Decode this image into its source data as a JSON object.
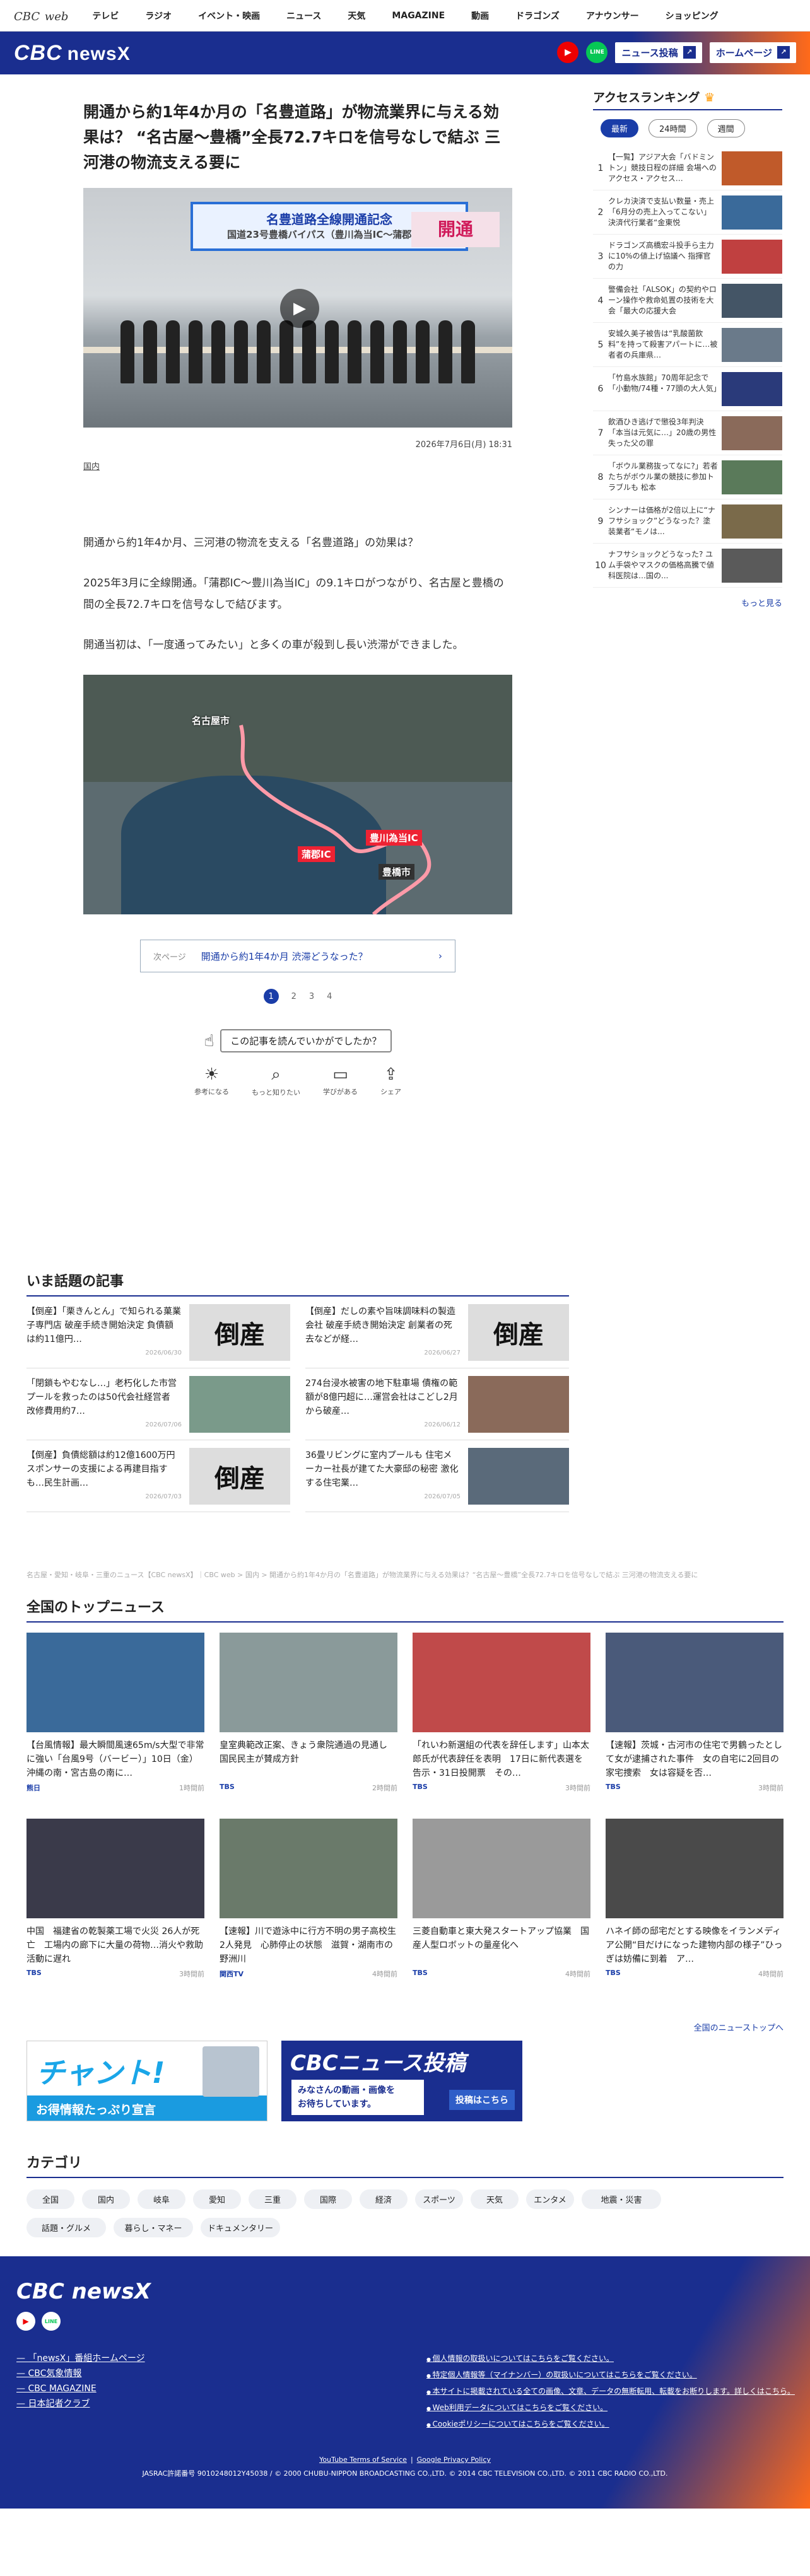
{
  "topnav": {
    "logo": "CBC",
    "logo_sub": "web",
    "items": [
      "テレビ",
      "ラジオ",
      "イベント・映画",
      "ニュース",
      "天気",
      "MAGAZINE",
      "動画",
      "ドラゴンズ",
      "アナウンサー",
      "ショッピング"
    ]
  },
  "header": {
    "brand": "CBC",
    "brand_sub": "newsX",
    "yt": "▶",
    "line": "LINE",
    "post": "ニュース投稿",
    "home": "ホームページ"
  },
  "article": {
    "title": "開通から約1年4か月の「名豊道路」が物流業界に与える効果は？ “名古屋～豊橋”全長72.7キロを信号なしで結ぶ 三河港の物流支える要に",
    "hero_arch": "名豊道路全線開通記念",
    "hero_arch_sub": "国道23号豊橋バイパス（豊川為当IC～蒲郡IC）",
    "hero_sign": "開通",
    "date": "2026年7月6日(月) 18:31",
    "category": "国内",
    "paras": [
      "開通から約1年4か月、三河港の物流を支える「名豊道路」の効果は？",
      "2025年3月に全線開通。「蒲郡IC～豊川為当IC」の9.1キロがつながり、名古屋と豊橋の間の全長72.7キロを信号なしで結びます。",
      "開通当初は、「一度通ってみたい」と多くの車が殺到し長い渋滞ができました。"
    ],
    "map": {
      "nagoya": "名古屋市",
      "gamagori": "蒲郡IC",
      "toyokawa": "豊川為当IC",
      "toyohashi": "豊橋市"
    },
    "next_label": "次ページ",
    "next_title": "開通から約1年4か月 渋滞どうなった？",
    "pages": [
      "1",
      "2",
      "3",
      "4"
    ],
    "ask": "この記事を読んでいかがでしたか？",
    "reactions": [
      {
        "i": "☀",
        "l": "参考になる"
      },
      {
        "i": "⌕",
        "l": "もっと知りたい"
      },
      {
        "i": "▭",
        "l": "学びがある"
      },
      {
        "i": "⇪",
        "l": "シェア"
      }
    ]
  },
  "ranking": {
    "title": "アクセスランキング",
    "tabs": [
      "最新",
      "24時間",
      "週間"
    ],
    "items": [
      {
        "n": "1",
        "t": "【一覧】アジア大会「バドミントン」競技日程の詳細 会場へのアクセス・アクセス…"
      },
      {
        "n": "2",
        "t": "クレカ決済で支払い数量・売上「6月分の売上入ってこない」決済代行業者“金東悦"
      },
      {
        "n": "3",
        "t": "ドラゴンズ高橋宏斗投手ら主力に10%の値上げ協議へ 指揮官の力"
      },
      {
        "n": "4",
        "t": "警備会社「ALSOK」の契約やローン操作や救命処置の技術を大会「最大の応援大会"
      },
      {
        "n": "5",
        "t": "安城久美子被告は“乳酸菌飲料”を持って殺害アパートに…被者者の兵庫県…"
      },
      {
        "n": "6",
        "t": "「竹島水族館」70周年記念で「小動物/74種・77頭の大人気」"
      },
      {
        "n": "7",
        "t": "飲酒ひき逃げで懲役3年判決「本当は元気に…」20歳の男性失った父の罪"
      },
      {
        "n": "8",
        "t": "「ボウル業務抜ってなに?」若者たちがボウル業の競技に参加トラブルも 松本"
      },
      {
        "n": "9",
        "t": "シンナーは価格が2倍以上に“ナフサショック”どうなった？塗装業者“モノは..."
      },
      {
        "n": "10",
        "t": "ナフサショックどうなった? ユム手袋やマスクの価格高騰で値科医院は…国の..."
      }
    ],
    "more": "もっと見る"
  },
  "trend": {
    "title": "いま話題の記事",
    "items": [
      {
        "t": "【倒産】「栗きんとん」で知られる菓業子専門店 破産手続き開始決定 負債額は約11億円…",
        "d": "2026/06/30",
        "im": "倒産"
      },
      {
        "t": "【倒産】だしの素や旨味調味料の製造会社 破産手続き開始決定 創業者の死去などが経…",
        "d": "2026/06/27",
        "im": "倒産"
      },
      {
        "t": "「閉鎖もやむなし…」老朽化した市営プールを救ったのは50代会社経営者 改修費用約7…",
        "d": "2026/07/06",
        "im": ""
      },
      {
        "t": "274台浸水被害の地下駐車場 債権の範額が8億円超に…運営会社はこどし2月から破産…",
        "d": "2026/06/12",
        "im": ""
      },
      {
        "t": "【倒産】負債総額は約12億1600万円 スポンサーの支援による再建目指すも…民生計画…",
        "d": "2026/07/03",
        "im": "倒産"
      },
      {
        "t": "36畳リビングに室内プールも 住宅メーカー社長が建てた大豪邸の秘密 激化する住宅業…",
        "d": "2026/07/05",
        "im": ""
      }
    ]
  },
  "breadcrumb": "名古屋・愛知・岐阜・三重のニュース【CBC newsX】｜CBC web > 国内 > 開通から約1年4か月の「名豊道路」が物流業界に与える効果は？“名古屋～豊橋”全長72.7キロを信号なしで結ぶ 三河港の物流支える要に",
  "tops": {
    "title": "全国のトップニュース",
    "items": [
      {
        "t": "【台風情報】最大瞬間風速65m/s大型で非常に強い「台風9号（バービー）」10日（金）沖縄の南・宮古島の南に…",
        "s": "熊日",
        "tm": "1時間前"
      },
      {
        "t": "皇室典範改正案、きょう衆院通過の見通し　国民民主が賛成方針",
        "s": "TBS",
        "tm": "2時間前"
      },
      {
        "t": "「れいわ新選組の代表を辞任します」山本太郎氏が代表辞任を表明　17日に新代表選を告示・31日投開票　その…",
        "s": "TBS",
        "tm": "3時間前"
      },
      {
        "t": "【速報】茨城・古河市の住宅で男鶴ったとして女が逮捕された事件　女の自宅に2回目の家宅捜索　女は容疑を否…",
        "s": "TBS",
        "tm": "3時間前"
      },
      {
        "t": "中国　福建省の乾製薬工場で火災 26人が死亡　工場内の廊下に大量の荷物…消火や救助活動に遅れ",
        "s": "TBS",
        "tm": "3時間前"
      },
      {
        "t": "【速報】川で遊泳中に行方不明の男子高校生2人発見　心肺停止の状態　滋賀・湖南市の野洲川",
        "s": "関西TV",
        "tm": "4時間前"
      },
      {
        "t": "三菱自動車と東大発スタートアップ協業　国産人型ロボットの量産化へ",
        "s": "TBS",
        "tm": "4時間前"
      },
      {
        "t": "ハネイ師の邸宅だとする映像をイランメディア公開“目だけになった建物内部の様子”ひっぎは妨備に到着　ア…",
        "s": "TBS",
        "tm": "4時間前"
      }
    ],
    "more": "全国のニューストップへ"
  },
  "banners": {
    "b1_title": "チャント!",
    "b1_sub": "お得情報たっぷり宣言",
    "b2_title": "CBCニュース投稿",
    "b2_sub": "みなさんの動画・画像を\nお待ちしています。",
    "b2_btn": "投稿はこちら"
  },
  "categories": {
    "title": "カテゴリ",
    "items": [
      "全国",
      "国内",
      "岐阜",
      "愛知",
      "三重",
      "国際",
      "経済",
      "スポーツ",
      "天気",
      "エンタメ",
      "地震・災害",
      "話題・グルメ",
      "暮らし・マネー",
      "ドキュメンタリー"
    ]
  },
  "footer": {
    "brand": "CBC newsX",
    "links": [
      "「newsX」番組ホームページ",
      "CBC気象情報",
      "CBC MAGAZINE",
      "日本記者クラブ"
    ],
    "legal": [
      "個人情報の取扱いについてはこちらをご覧ください。",
      "特定個人情報等（マイナンバー）の取扱いについてはこちらをご覧ください。",
      "本サイトに掲載されている全ての画像、文章、データの無断転用、転載をお断りします。詳しくはこちら。",
      "Web利用データについてはこちらをご覧ください。",
      "Cookieポリシーについてはこちらをご覧ください。"
    ],
    "yt_terms": "YouTube Terms of Service",
    "gpp": "Google Privacy Policy",
    "copyright": "JASRAC許諾番号 9010248012Y45038 / © 2000 CHUBU-NIPPON BROADCASTING CO.,LTD. © 2014 CBC TELEVISION CO.,LTD. © 2011 CBC RADIO CO.,LTD."
  },
  "colors": {
    "navy": "#1a2e8f",
    "orange": "#ff6a1a",
    "accent": "#1a3da8"
  }
}
